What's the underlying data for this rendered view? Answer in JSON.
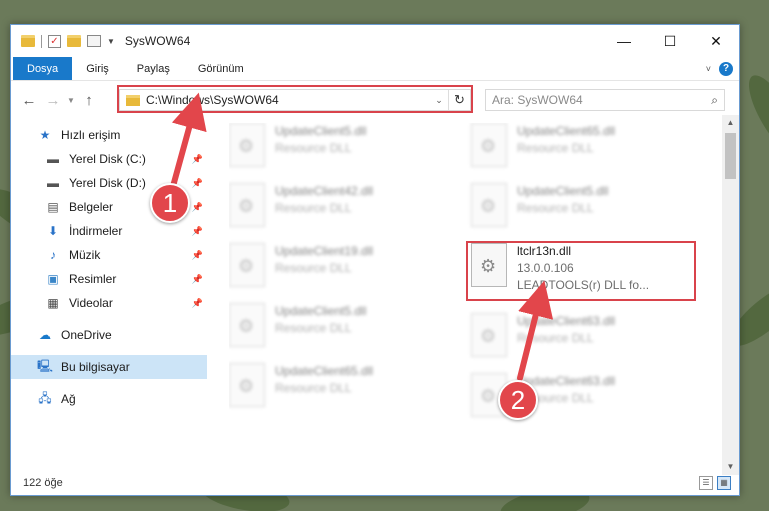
{
  "window": {
    "title": "SysWOW64",
    "controls": {
      "minimize": "—",
      "maximize": "☐",
      "close": "✕"
    }
  },
  "ribbon": {
    "tabs": [
      {
        "label": "Dosya"
      },
      {
        "label": "Giriş"
      },
      {
        "label": "Paylaş"
      },
      {
        "label": "Görünüm"
      }
    ],
    "help": "?"
  },
  "address": {
    "path": "C:\\Windows\\SysWOW64",
    "search_placeholder": "Ara: SysWOW64"
  },
  "sidebar": {
    "quick_access": "Hızlı erişim",
    "pinned": [
      {
        "label": "Yerel Disk (C:)",
        "icon": "drive-icon"
      },
      {
        "label": "Yerel Disk (D:)",
        "icon": "drive-icon"
      },
      {
        "label": "Belgeler",
        "icon": "documents-icon"
      },
      {
        "label": "İndirmeler",
        "icon": "downloads-icon"
      },
      {
        "label": "Müzik",
        "icon": "music-icon"
      },
      {
        "label": "Resimler",
        "icon": "pictures-icon"
      },
      {
        "label": "Videolar",
        "icon": "videos-icon"
      }
    ],
    "onedrive": "OneDrive",
    "this_pc": "Bu bilgisayar",
    "network": "Ağ"
  },
  "files": {
    "left_column": [
      {
        "name": "UpdateClient5.dll",
        "desc": "Resource DLL"
      },
      {
        "name": "UpdateClient42.dll",
        "desc": "Resource DLL"
      },
      {
        "name": "UpdateClient19.dll",
        "desc": "Resource DLL"
      },
      {
        "name": "UpdateClient5.dll",
        "desc": "Resource DLL"
      },
      {
        "name": "UpdateClient65.dll",
        "desc": "Resource DLL"
      }
    ],
    "right_column": [
      {
        "name": "UpdateClient65.dll",
        "desc": "Resource DLL"
      },
      {
        "name": "UpdateClient5.dll",
        "desc": "Resource DLL"
      },
      {
        "name": "UpdateClient63.dll",
        "desc": "Resource DLL"
      },
      {
        "name": "UpdateClient63.dll",
        "desc": "Resource DLL"
      }
    ],
    "target": {
      "name": "ltclr13n.dll",
      "version": "13.0.0.106",
      "desc": "LEADTOOLS(r) DLL fo..."
    }
  },
  "status": {
    "count": "122 öğe"
  },
  "annotations": {
    "step1": "1",
    "step2": "2",
    "color": "#e2464b"
  }
}
